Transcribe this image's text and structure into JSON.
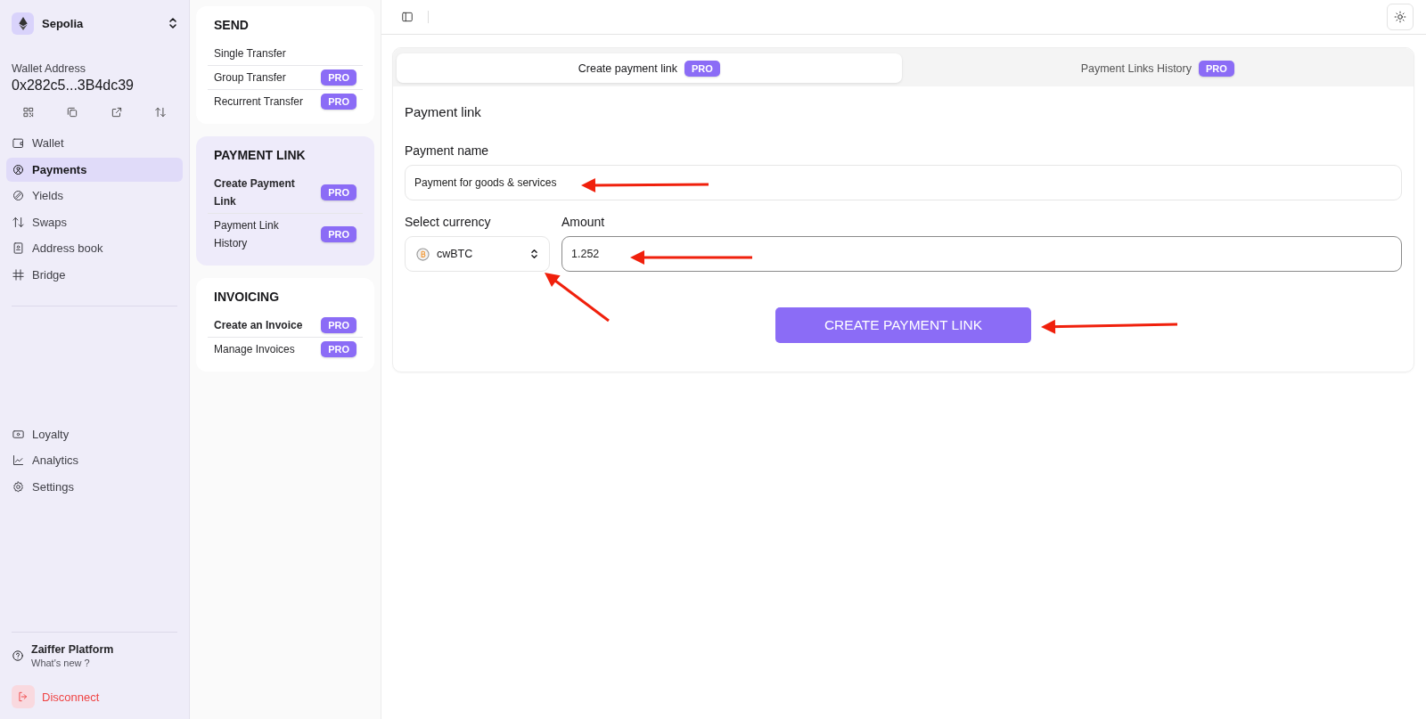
{
  "network": {
    "name": "Sepolia"
  },
  "wallet": {
    "label": "Wallet Address",
    "address": "0x282c5...3B4dc39"
  },
  "wallet_actions": [
    {
      "kind": "qr"
    },
    {
      "kind": "copy"
    },
    {
      "kind": "external"
    },
    {
      "kind": "swap"
    }
  ],
  "nav": [
    {
      "label": "Wallet",
      "kind": "wallet",
      "selected": false
    },
    {
      "label": "Payments",
      "kind": "payments",
      "selected": true
    },
    {
      "label": "Yields",
      "kind": "yields",
      "selected": false
    },
    {
      "label": "Swaps",
      "kind": "swap",
      "selected": false
    },
    {
      "label": "Address book",
      "kind": "book",
      "selected": false
    },
    {
      "label": "Bridge",
      "kind": "bridge",
      "selected": false
    }
  ],
  "nav_bottom": [
    {
      "label": "Loyalty",
      "kind": "ticket",
      "selected": false
    },
    {
      "label": "Analytics",
      "kind": "chart",
      "selected": false
    },
    {
      "label": "Settings",
      "kind": "gear",
      "selected": false
    }
  ],
  "footer": {
    "title": "Zaiffer Platform",
    "subtitle": "What's new ?"
  },
  "disconnect": "Disconnect",
  "menu_sections": [
    {
      "title": "SEND",
      "selected": false,
      "items": [
        {
          "label": "Single Transfer",
          "emphasized": false
        },
        {
          "label": "Group Transfer",
          "emphasized": false,
          "badge": "PRO"
        },
        {
          "label": "Recurrent Transfer",
          "emphasized": false,
          "badge": "PRO"
        }
      ]
    },
    {
      "title": "PAYMENT LINK",
      "selected": true,
      "items": [
        {
          "label": "Create Payment Link",
          "emphasized": true,
          "badge": "PRO"
        },
        {
          "label": "Payment Link History",
          "emphasized": false,
          "badge": "PRO"
        }
      ]
    },
    {
      "title": "INVOICING",
      "selected": false,
      "items": [
        {
          "label": "Create an Invoice",
          "emphasized": true,
          "badge": "PRO"
        },
        {
          "label": "Manage Invoices",
          "emphasized": false,
          "badge": "PRO"
        }
      ]
    }
  ],
  "tabs": [
    {
      "label": "Create payment link",
      "badge": "PRO",
      "selected": true
    },
    {
      "label": "Payment Links History",
      "badge": "PRO",
      "selected": false
    }
  ],
  "form": {
    "title": "Payment link",
    "payment_name": {
      "label": "Payment name",
      "value": "Payment for goods & services"
    },
    "currency": {
      "label": "Select currency",
      "value": "cwBTC"
    },
    "amount": {
      "label": "Amount",
      "value": "1.252"
    },
    "submit": "CREATE PAYMENT LINK"
  }
}
